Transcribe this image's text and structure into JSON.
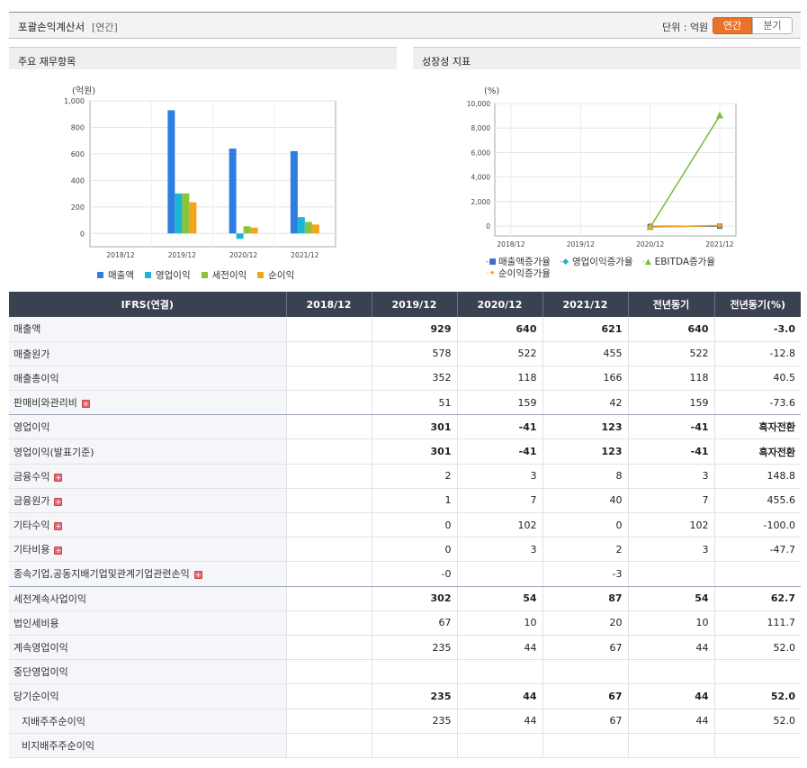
{
  "header": {
    "title": "포괄손익계산서",
    "period_type": "[연간]",
    "unit_label": "단위 : 억원",
    "toggle_annual": "연간",
    "toggle_quarter": "분기"
  },
  "panels": {
    "left_title": "주요 재무항목",
    "right_title": "성장성 지표"
  },
  "chart_data": [
    {
      "type": "bar",
      "unit": "(억원)",
      "categories": [
        "2018/12",
        "2019/12",
        "2020/12",
        "2021/12"
      ],
      "ylim": [
        -100,
        1000
      ],
      "yticks": [
        {
          "value": 1000,
          "label": "1,000"
        },
        {
          "value": 800,
          "label": "800"
        },
        {
          "value": 600,
          "label": "600"
        },
        {
          "value": 400,
          "label": "400"
        },
        {
          "value": 200,
          "label": "200"
        },
        {
          "value": 0,
          "label": "0"
        }
      ],
      "series": [
        {
          "name": "매출액",
          "color": "#2e7de0",
          "values": [
            null,
            929,
            640,
            621
          ]
        },
        {
          "name": "영업이익",
          "color": "#1cb5d4",
          "values": [
            null,
            301,
            -41,
            123
          ]
        },
        {
          "name": "세전이익",
          "color": "#8ac43f",
          "values": [
            null,
            302,
            54,
            87
          ]
        },
        {
          "name": "순이익",
          "color": "#f5a31a",
          "values": [
            null,
            235,
            44,
            67
          ]
        }
      ],
      "grid": true,
      "legend_position": "bottom"
    },
    {
      "type": "line",
      "unit": "(%)",
      "categories": [
        "2018/12",
        "2019/12",
        "2020/12",
        "2021/12"
      ],
      "ylim": [
        -800,
        10000
      ],
      "yticks": [
        {
          "value": 10000,
          "label": "10,000"
        },
        {
          "value": 8000,
          "label": "8,000"
        },
        {
          "value": 6000,
          "label": "6,000"
        },
        {
          "value": 4000,
          "label": "4,000"
        },
        {
          "value": 2000,
          "label": "2,000"
        },
        {
          "value": 0,
          "label": "0"
        }
      ],
      "series": [
        {
          "name": "매출액증가율",
          "color": "#3a6fc4",
          "marker": "square",
          "values": [
            null,
            null,
            -31,
            -3
          ]
        },
        {
          "name": "영업이익증가율",
          "color": "#1cb5d4",
          "marker": "diamond",
          "values": [
            null,
            null,
            null,
            null
          ]
        },
        {
          "name": "EBITDA증가율",
          "color": "#7fbf3f",
          "marker": "triangle",
          "values": [
            null,
            null,
            -100,
            9000
          ]
        },
        {
          "name": "순이익증가율",
          "color": "#f5a31a",
          "marker": "star",
          "values": [
            null,
            null,
            -81,
            52
          ]
        }
      ],
      "grid": true,
      "legend_position": "bottom"
    }
  ],
  "table": {
    "columns": [
      "IFRS(연결)",
      "2018/12",
      "2019/12",
      "2020/12",
      "2021/12",
      "전년동기",
      "전년동기(%)"
    ],
    "rows": [
      {
        "label": "매출액",
        "expand": false,
        "bold": true,
        "values": [
          "",
          "929",
          "640",
          "621",
          "640",
          "-3.0"
        ]
      },
      {
        "label": "매출원가",
        "expand": false,
        "bold": false,
        "values": [
          "",
          "578",
          "522",
          "455",
          "522",
          "-12.8"
        ]
      },
      {
        "label": "매출총이익",
        "expand": false,
        "bold": false,
        "values": [
          "",
          "352",
          "118",
          "166",
          "118",
          "40.5"
        ]
      },
      {
        "label": "판매비와관리비",
        "expand": true,
        "bold": false,
        "values": [
          "",
          "51",
          "159",
          "42",
          "159",
          "-73.6"
        ]
      },
      {
        "label": "영업이익",
        "expand": false,
        "bold": true,
        "values": [
          "",
          "301",
          "-41",
          "123",
          "-41",
          "흑자전환"
        ]
      },
      {
        "label": "영업이익(발표기준)",
        "expand": false,
        "bold": true,
        "values": [
          "",
          "301",
          "-41",
          "123",
          "-41",
          "흑자전환"
        ]
      },
      {
        "label": "금융수익",
        "expand": true,
        "bold": false,
        "values": [
          "",
          "2",
          "3",
          "8",
          "3",
          "148.8"
        ]
      },
      {
        "label": "금융원가",
        "expand": true,
        "bold": false,
        "values": [
          "",
          "1",
          "7",
          "40",
          "7",
          "455.6"
        ]
      },
      {
        "label": "기타수익",
        "expand": true,
        "bold": false,
        "values": [
          "",
          "0",
          "102",
          "0",
          "102",
          "-100.0"
        ]
      },
      {
        "label": "기타비용",
        "expand": true,
        "bold": false,
        "values": [
          "",
          "0",
          "3",
          "2",
          "3",
          "-47.7"
        ]
      },
      {
        "label": "종속기업,공동지배기업및관계기업관련손익",
        "expand": true,
        "bold": false,
        "values": [
          "",
          "-0",
          "",
          "-3",
          "",
          ""
        ]
      },
      {
        "label": "세전계속사업이익",
        "expand": false,
        "bold": true,
        "values": [
          "",
          "302",
          "54",
          "87",
          "54",
          "62.7"
        ]
      },
      {
        "label": "법인세비용",
        "expand": false,
        "bold": false,
        "values": [
          "",
          "67",
          "10",
          "20",
          "10",
          "111.7"
        ]
      },
      {
        "label": "계속영업이익",
        "expand": false,
        "bold": false,
        "values": [
          "",
          "235",
          "44",
          "67",
          "44",
          "52.0"
        ]
      },
      {
        "label": "중단영업이익",
        "expand": false,
        "bold": false,
        "values": [
          "",
          "",
          "",
          "",
          "",
          ""
        ]
      },
      {
        "label": "당기순이익",
        "expand": false,
        "bold": true,
        "values": [
          "",
          "235",
          "44",
          "67",
          "44",
          "52.0"
        ]
      },
      {
        "label": "지배주주순이익",
        "expand": false,
        "bold": false,
        "indent": true,
        "values": [
          "",
          "235",
          "44",
          "67",
          "44",
          "52.0"
        ]
      },
      {
        "label": "비지배주주순이익",
        "expand": false,
        "bold": false,
        "indent": true,
        "values": [
          "",
          "",
          "",
          "",
          "",
          ""
        ]
      }
    ]
  }
}
